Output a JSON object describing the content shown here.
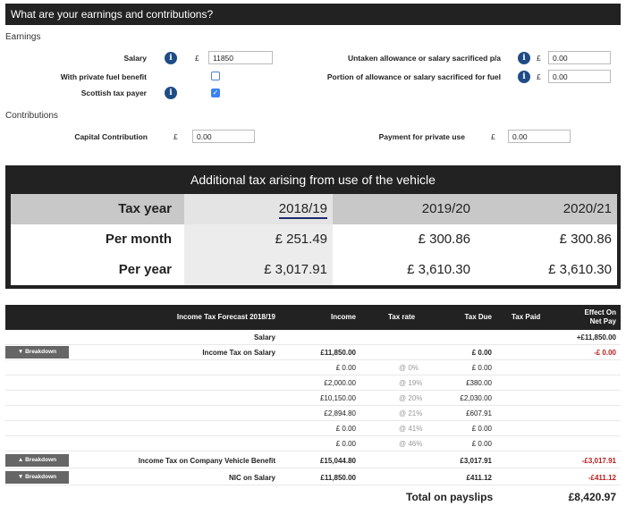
{
  "header": {
    "title": "What are your earnings and contributions?"
  },
  "earnings": {
    "section_label": "Earnings",
    "salary_label": "Salary",
    "salary_currency": "£",
    "salary_value": "11850",
    "fuel_benefit_label": "With private fuel benefit",
    "scottish_label": "Scottish tax payer",
    "untaken_label": "Untaken allowance or salary sacrificed p/a",
    "untaken_currency": "£",
    "untaken_value": "0.00",
    "portion_label": "Portion of allowance or salary sacrificed for fuel",
    "portion_currency": "£",
    "portion_value": "0.00",
    "info_glyph": "i",
    "check_glyph": "✓"
  },
  "contributions": {
    "section_label": "Contributions",
    "capital_label": "Capital Contribution",
    "capital_currency": "£",
    "capital_value": "0.00",
    "private_use_label": "Payment for private use",
    "private_use_currency": "£",
    "private_use_value": "0.00"
  },
  "vehicle_tax": {
    "title": "Additional tax arising from use of the vehicle",
    "tax_year_label": "Tax year",
    "years": [
      "2018/19",
      "2019/20",
      "2020/21"
    ],
    "per_month_label": "Per month",
    "per_month": [
      "£ 251.49",
      "£ 300.86",
      "£ 300.86"
    ],
    "per_year_label": "Per year",
    "per_year": [
      "£ 3,017.91",
      "£ 3,610.30",
      "£ 3,610.30"
    ]
  },
  "forecast": {
    "headers": {
      "title": "Income Tax Forecast 2018/19",
      "income": "Income",
      "tax_rate": "Tax rate",
      "tax_due": "Tax Due",
      "tax_paid": "Tax Paid",
      "effect_line1": "Effect On",
      "effect_line2": "Net Pay"
    },
    "breakdown_label": "Breakdown",
    "arrow_down": "▼",
    "arrow_up": "▲",
    "salary_row": {
      "label": "Salary",
      "effect": "+£11,850.00"
    },
    "income_tax_row": {
      "label": "Income Tax on Salary",
      "income": "£11,850.00",
      "tax_due": "£ 0.00",
      "effect": "-£ 0.00"
    },
    "bands": [
      {
        "income": "£ 0.00",
        "rate": "@ 0%",
        "due": "£ 0.00"
      },
      {
        "income": "£2,000.00",
        "rate": "@ 19%",
        "due": "£380.00"
      },
      {
        "income": "£10,150.00",
        "rate": "@ 20%",
        "due": "£2,030.00"
      },
      {
        "income": "£2,894.80",
        "rate": "@ 21%",
        "due": "£607.91"
      },
      {
        "income": "£ 0.00",
        "rate": "@ 41%",
        "due": "£ 0.00"
      },
      {
        "income": "£ 0.00",
        "rate": "@ 46%",
        "due": "£ 0.00"
      }
    ],
    "vehicle_benefit_row": {
      "label": "Income Tax on Company Vehicle Benefit",
      "income": "£15,044.80",
      "tax_due": "£3,017.91",
      "effect": "-£3,017.91"
    },
    "nic_row": {
      "label": "NIC on Salary",
      "income": "£11,850.00",
      "tax_due": "£411.12",
      "effect": "-£411.12"
    },
    "total": {
      "label": "Total on payslips",
      "value": "£8,420.97"
    }
  },
  "colors": {
    "header_bg": "#222222",
    "info_blue": "#1f4c86",
    "negative_red": "#b91c1c",
    "breakdown_grey": "#666666"
  }
}
